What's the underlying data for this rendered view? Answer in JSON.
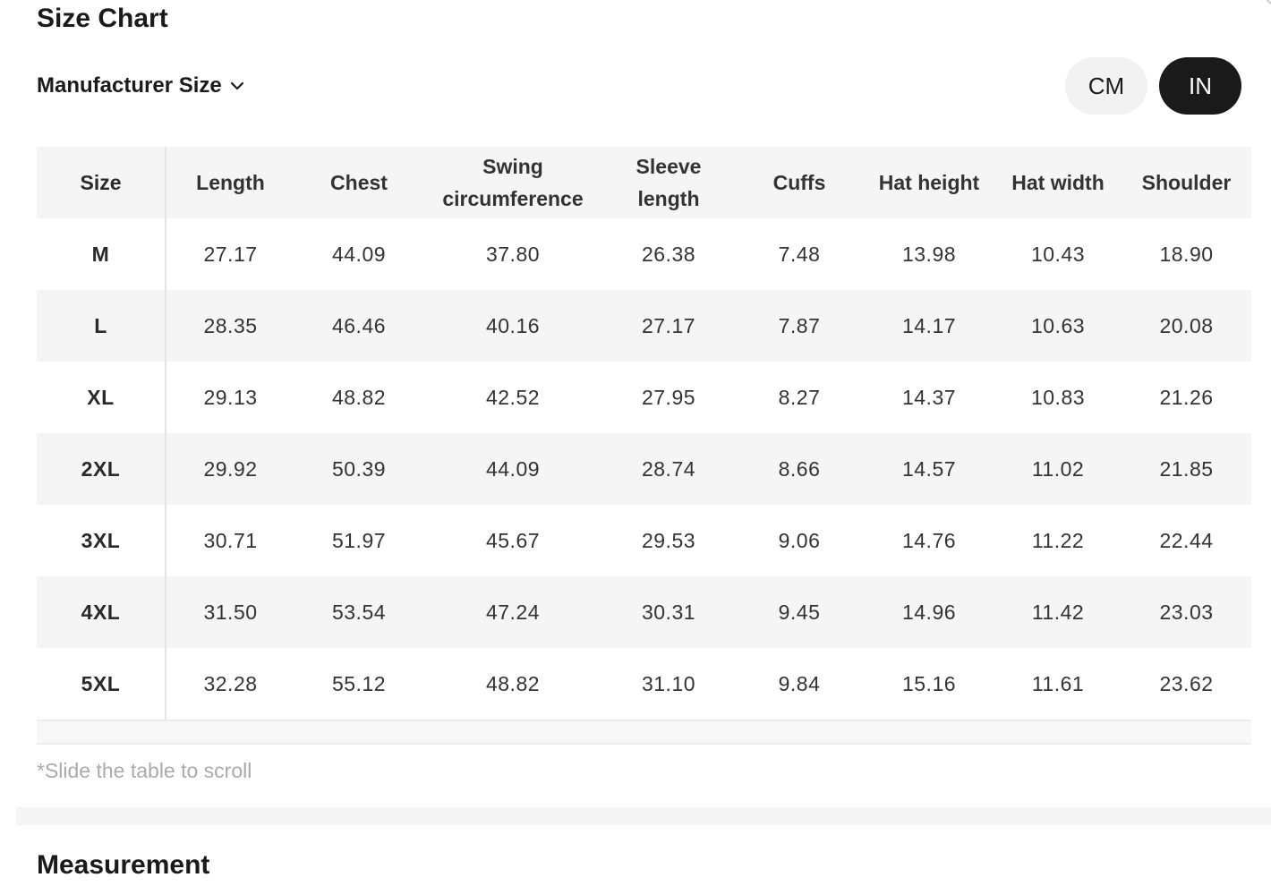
{
  "header": {
    "title": "Size Chart",
    "size_selector_label": "Manufacturer Size"
  },
  "units": {
    "options": [
      "CM",
      "IN"
    ],
    "selected": "IN"
  },
  "table": {
    "columns": [
      "Size",
      "Length",
      "Chest",
      "Swing circumference",
      "Sleeve length",
      "Cuffs",
      "Hat height",
      "Hat width",
      "Shoulder"
    ],
    "rows": [
      [
        "M",
        "27.17",
        "44.09",
        "37.80",
        "26.38",
        "7.48",
        "13.98",
        "10.43",
        "18.90"
      ],
      [
        "L",
        "28.35",
        "46.46",
        "40.16",
        "27.17",
        "7.87",
        "14.17",
        "10.63",
        "20.08"
      ],
      [
        "XL",
        "29.13",
        "48.82",
        "42.52",
        "27.95",
        "8.27",
        "14.37",
        "10.83",
        "21.26"
      ],
      [
        "2XL",
        "29.92",
        "50.39",
        "44.09",
        "28.74",
        "8.66",
        "14.57",
        "11.02",
        "21.85"
      ],
      [
        "3XL",
        "30.71",
        "51.97",
        "45.67",
        "29.53",
        "9.06",
        "14.76",
        "11.22",
        "22.44"
      ],
      [
        "4XL",
        "31.50",
        "53.54",
        "47.24",
        "30.31",
        "9.45",
        "14.96",
        "11.42",
        "23.03"
      ],
      [
        "5XL",
        "32.28",
        "55.12",
        "48.82",
        "31.10",
        "9.84",
        "15.16",
        "11.61",
        "23.62"
      ]
    ]
  },
  "footer": {
    "scroll_hint": "*Slide the table to scroll",
    "next_section_title": "Measurement"
  },
  "icons": {
    "dropdown": "chevron-down-icon"
  },
  "colors": {
    "active_toggle_bg": "#1a1a1a",
    "inactive_toggle_bg": "#f2f2f2",
    "stripe_bg": "#f5f5f5",
    "hint_text": "#aaaaaa"
  }
}
